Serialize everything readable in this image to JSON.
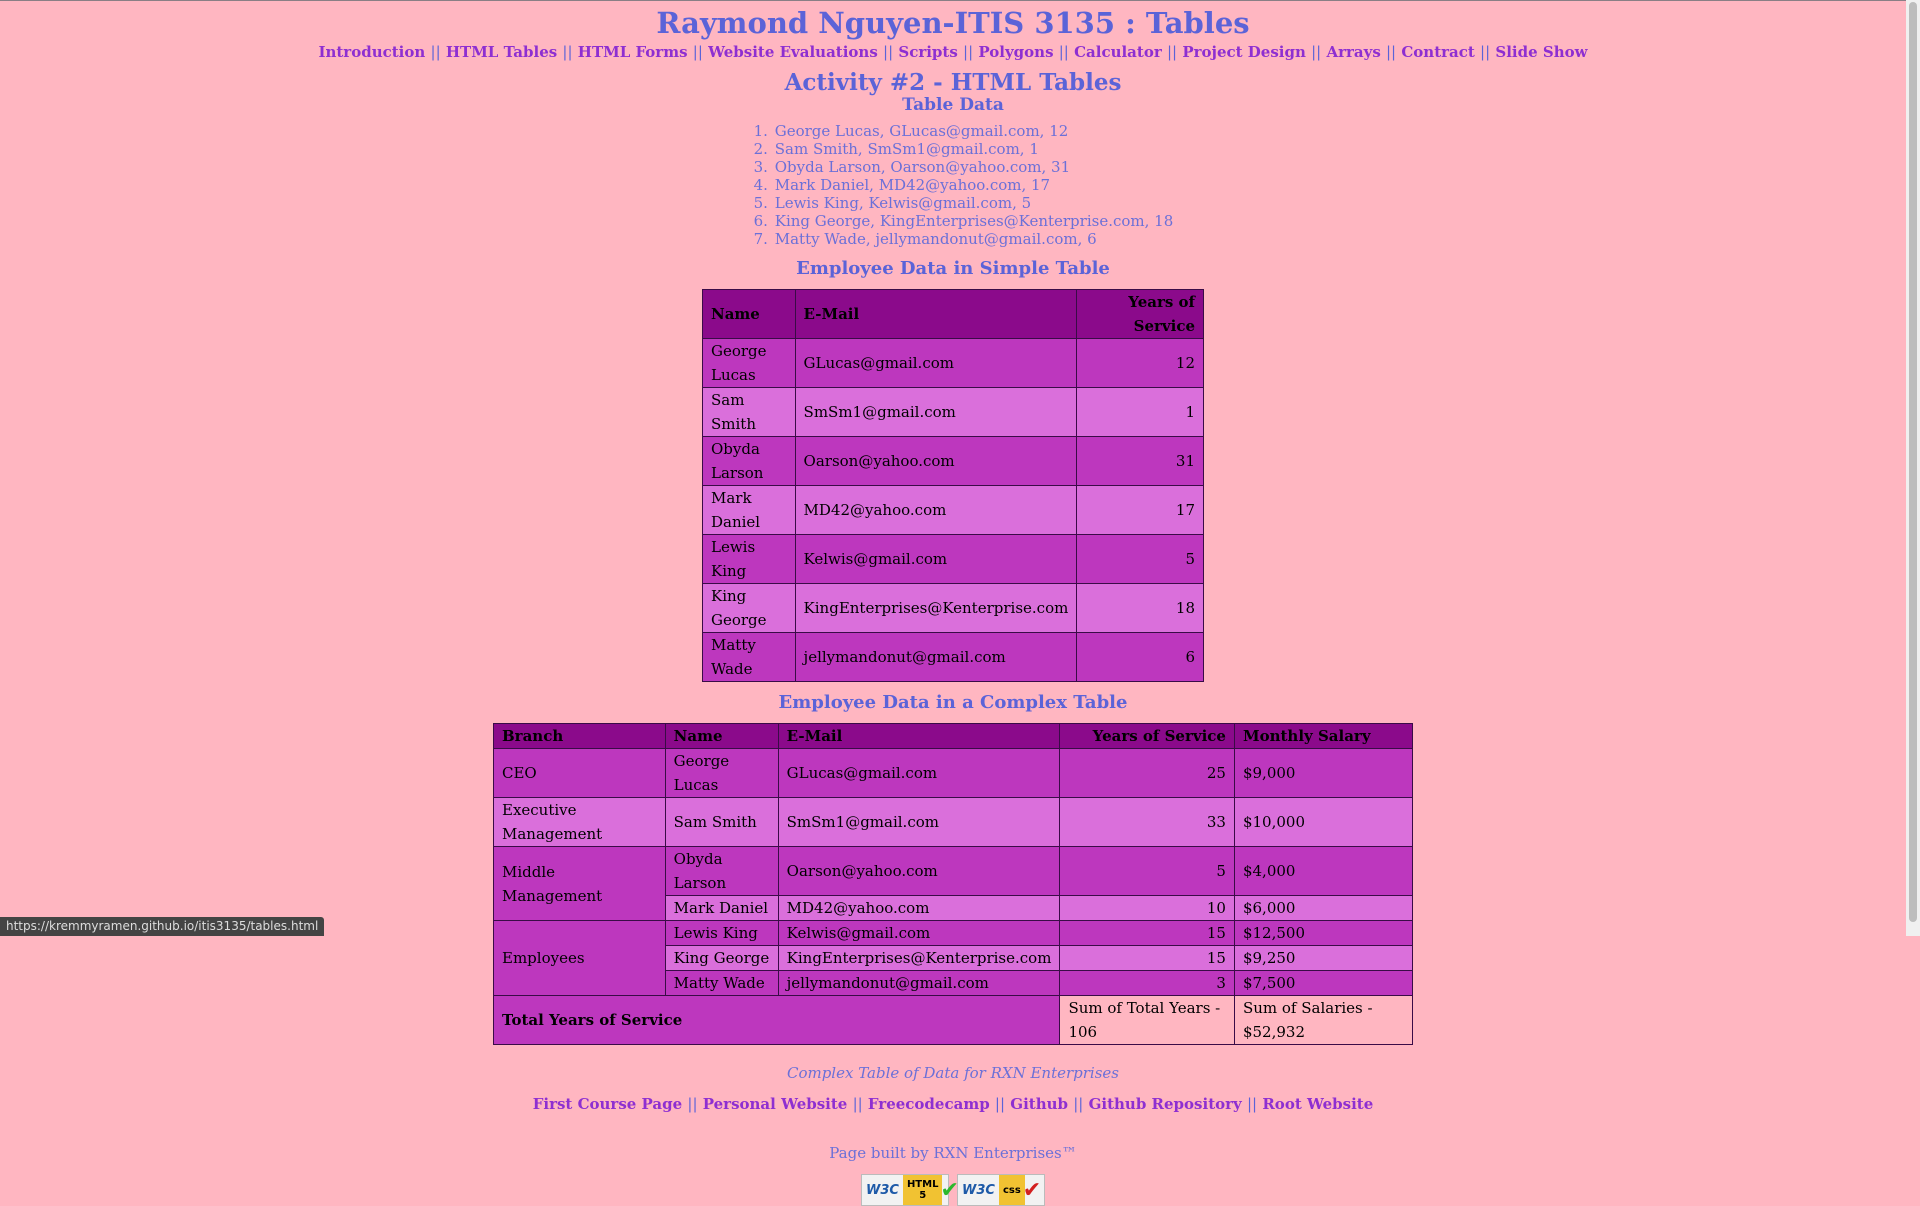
{
  "page": {
    "title": "Raymond Nguyen-ITIS 3135 : Tables",
    "nav": [
      "Introduction",
      "HTML Tables",
      "HTML Forms",
      "Website Evaluations",
      "Scripts",
      "Polygons",
      "Calculator",
      "Project Design",
      "Arrays",
      "Contract",
      "Slide Show"
    ],
    "separator": "||",
    "activity_title": "Activity #2 - HTML Tables",
    "table_data_heading": "Table Data",
    "table_data_items": [
      "George Lucas, GLucas@gmail.com, 12",
      "Sam Smith, SmSm1@gmail.com, 1",
      "Obyda Larson, Oarson@yahoo.com, 31",
      "Mark Daniel, MD42@yahoo.com, 17",
      "Lewis King, Kelwis@gmail.com, 5",
      "King George, KingEnterprises@Kenterprise.com, 18",
      "Matty Wade, jellymandonut@gmail.com, 6"
    ]
  },
  "simple_table": {
    "heading": "Employee Data in Simple Table",
    "columns": [
      "Name",
      "E-Mail",
      "Years of Service"
    ],
    "rows": [
      [
        "George Lucas",
        "GLucas@gmail.com",
        "12"
      ],
      [
        "Sam Smith",
        "SmSm1@gmail.com",
        "1"
      ],
      [
        "Obyda Larson",
        "Oarson@yahoo.com",
        "31"
      ],
      [
        "Mark Daniel",
        "MD42@yahoo.com",
        "17"
      ],
      [
        "Lewis King",
        "Kelwis@gmail.com",
        "5"
      ],
      [
        "King George",
        "KingEnterprises@Kenterprise.com",
        "18"
      ],
      [
        "Matty Wade",
        "jellymandonut@gmail.com",
        "6"
      ]
    ]
  },
  "complex_table": {
    "heading": "Employee Data in a Complex Table",
    "columns": [
      "Branch",
      "Name",
      "E-Mail",
      "Years of Service",
      "Monthly Salary"
    ],
    "groups": [
      {
        "branch": "CEO",
        "rows": [
          [
            "George Lucas",
            "GLucas@gmail.com",
            "25",
            "$9,000"
          ]
        ]
      },
      {
        "branch": "Executive Management",
        "rows": [
          [
            "Sam Smith",
            "SmSm1@gmail.com",
            "33",
            "$10,000"
          ]
        ]
      },
      {
        "branch": "Middle Management",
        "rows": [
          [
            "Obyda Larson",
            "Oarson@yahoo.com",
            "5",
            "$4,000"
          ],
          [
            "Mark Daniel",
            "MD42@yahoo.com",
            "10",
            "$6,000"
          ]
        ]
      },
      {
        "branch": "Employees",
        "rows": [
          [
            "Lewis King",
            "Kelwis@gmail.com",
            "15",
            "$12,500"
          ],
          [
            "King George",
            "KingEnterprises@Kenterprise.com",
            "15",
            "$9,250"
          ],
          [
            "Matty Wade",
            "jellymandonut@gmail.com",
            "3",
            "$7,500"
          ]
        ]
      }
    ],
    "footer": {
      "label": "Total Years of Service",
      "years": "Sum of Total Years - 106",
      "salary": "Sum of Salaries - $52,932"
    },
    "caption": "Complex Table of Data for RXN Enterprises"
  },
  "footer": {
    "links": [
      "First Course Page",
      "Personal Website",
      "Freecodecamp",
      "Github",
      "Github Repository",
      "Root Website"
    ],
    "built_by": "Page built by RXN Enterprises™",
    "badges": [
      {
        "icon": "w3c-html5-badge",
        "w3c": "W3C",
        "label": "HTML 5",
        "check": "checkmark-icon"
      },
      {
        "icon": "w3c-css-badge",
        "w3c": "W3C",
        "label": "css",
        "check": "checkmark-icon"
      }
    ]
  },
  "browser": {
    "status_url": "https://kremmyramen.github.io/itis3135/tables.html"
  },
  "colors": {
    "background": "#ffb6c1",
    "heading": "#5b63d8",
    "link": "#8e2fd1",
    "table_header": "#8b0a8b",
    "row_dark": "#bd37be",
    "row_light": "#da6fdb"
  }
}
